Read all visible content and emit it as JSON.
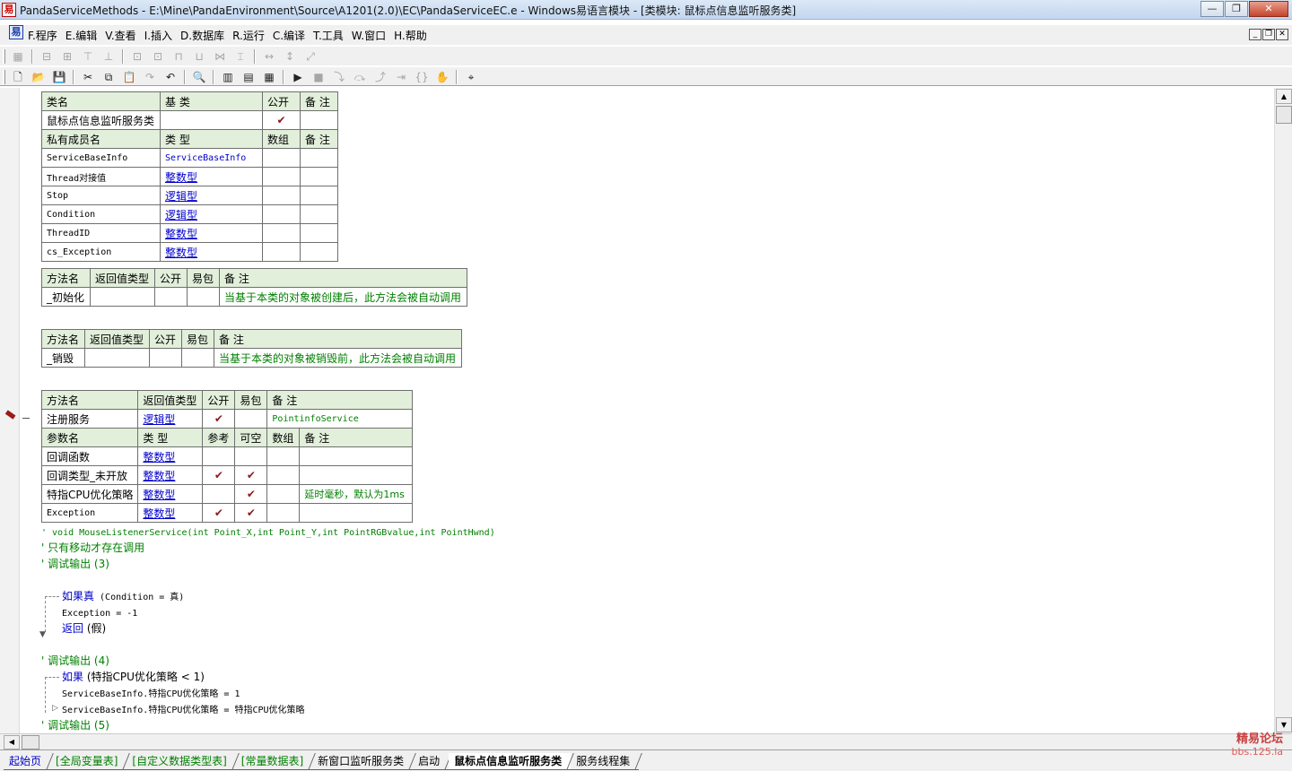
{
  "window": {
    "title": "PandaServiceMethods - E:\\Mine\\PandaEnvironment\\Source\\A1201(2.0)\\EC\\PandaServiceEC.e - Windows易语言模块 - [类模块: 鼠标点信息监听服务类]",
    "minimize": "—",
    "restore": "❐",
    "close": "✕"
  },
  "menu": [
    "F.程序",
    "E.编辑",
    "V.查看",
    "I.插入",
    "D.数据库",
    "R.运行",
    "C.编译",
    "T.工具",
    "W.窗口",
    "H.帮助"
  ],
  "class_table": {
    "headers": [
      "类名",
      "基 类",
      "公开",
      "备 注"
    ],
    "row": {
      "name": "鼠标点信息监听服务类",
      "base": "",
      "public": "✔",
      "note": ""
    },
    "member_headers": [
      "私有成员名",
      "类 型",
      "数组",
      "备 注"
    ],
    "members": [
      {
        "name": "ServiceBaseInfo",
        "type": "ServiceBaseInfo"
      },
      {
        "name": "Thread对接值",
        "type": "整数型"
      },
      {
        "name": "Stop",
        "type": "逻辑型"
      },
      {
        "name": "Condition",
        "type": "逻辑型"
      },
      {
        "name": "ThreadID",
        "type": "整数型"
      },
      {
        "name": "cs_Exception",
        "type": "整数型"
      }
    ]
  },
  "method_init": {
    "headers": [
      "方法名",
      "返回值类型",
      "公开",
      "易包",
      "备 注"
    ],
    "name": "_初始化",
    "note": "当基于本类的对象被创建后，此方法会被自动调用"
  },
  "method_destroy": {
    "headers": [
      "方法名",
      "返回值类型",
      "公开",
      "易包",
      "备 注"
    ],
    "name": "_销毁",
    "note": "当基于本类的对象被销毁前，此方法会被自动调用"
  },
  "method_register": {
    "headers": [
      "方法名",
      "返回值类型",
      "公开",
      "易包",
      "备 注"
    ],
    "name": "注册服务",
    "return_type": "逻辑型",
    "public": "✔",
    "note": "PointinfoService",
    "param_headers": [
      "参数名",
      "类 型",
      "参考",
      "可空",
      "数组",
      "备 注"
    ],
    "params": [
      {
        "name": "回调函数",
        "type": "整数型",
        "ref": "",
        "nullable": "",
        "array": "",
        "note": ""
      },
      {
        "name": "回调类型_未开放",
        "type": "整数型",
        "ref": "✔",
        "nullable": "✔",
        "array": "",
        "note": ""
      },
      {
        "name": "特指CPU优化策略",
        "type": "整数型",
        "ref": "",
        "nullable": "✔",
        "array": "",
        "note": "延时毫秒，默认为1ms"
      },
      {
        "name": "Exception",
        "type": "整数型",
        "ref": "✔",
        "nullable": "✔",
        "array": "",
        "note": ""
      }
    ]
  },
  "code": {
    "c1": "' void MouseListenerService(int Point_X,int Point_Y,int PointRGBvalue,int PointHwnd)",
    "c2": "' 只有移动才存在调用",
    "c3": "' 调试输出 (3)",
    "if1_kw": "如果真",
    "if1_cond": " (Condition = 真)",
    "l_exc": "Exception = -1",
    "ret_kw": "返回",
    "ret_val": " (假)",
    "c4": "' 调试输出 (4)",
    "if2_kw": "如果",
    "if2_cond": " (特指CPU优化策略 < 1)",
    "l_s1": "ServiceBaseInfo.特指CPU优化策略 = 1",
    "l_s2": "ServiceBaseInfo.特指CPU优化策略 = 特指CPU优化策略",
    "c5": "' 调试输出 (5)"
  },
  "tabs": [
    "起始页",
    "[全局变量表]",
    "[自定义数据类型表]",
    "[常量数据表]",
    "新窗口监听服务类",
    "启动",
    "鼠标点信息监听服务类",
    "服务线程集"
  ],
  "watermark": {
    "line1": "精易论坛",
    "line2": "bbs.125.la"
  },
  "icons": {
    "app": "e-language-icon",
    "toolbar": [
      "new-file-icon",
      "open-icon",
      "save-icon",
      "cut-icon",
      "copy-icon",
      "paste-icon",
      "redo-icon",
      "undo-icon",
      "find-icon",
      "layout1-icon",
      "layout2-icon",
      "layout3-icon",
      "run-icon",
      "stop-icon",
      "debug-icons"
    ]
  }
}
